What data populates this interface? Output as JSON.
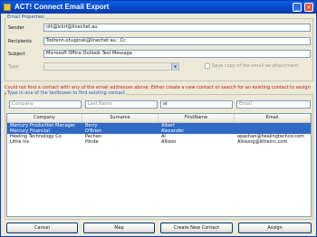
{
  "window": {
    "title": "ACT! Connect Email Export",
    "minimize_glyph": "_",
    "close_glyph": "×"
  },
  "email_properties": {
    "legend": "Email Properties",
    "sender_label": "Sender",
    "sender_value": "olh@ickrt@linechet.au",
    "recipients_label": "Recipients",
    "recipients_value": "Todrenn.ohuginsk@linechet.au ; Cc",
    "subject_label": "Subject",
    "subject_value": "Microsoft Office Outlook Test Message",
    "type_label": "Type",
    "type_value": "",
    "save_copy_label": "Save copy of the email as attachment",
    "save_copy_checked": false
  },
  "warning": "Could not find a contact with any of the email addresses above. Either create a new contact or search for an existing contact to assign email message to.",
  "search": {
    "legend": "Type in one of the textboxes to find existing contact",
    "company_placeholder": "Company",
    "lastname_placeholder": "Last Name",
    "firstname_value": "al",
    "email_placeholder": "Email"
  },
  "grid": {
    "columns": [
      "Company",
      "Surname",
      "FirstName",
      "Email"
    ],
    "rows": [
      {
        "company": "Mercury Production Manager",
        "surname": "Berry",
        "firstname": "Albert",
        "email": "",
        "selected": true
      },
      {
        "company": "Mercury Financial",
        "surname": "O'Brien",
        "firstname": "Alexander",
        "email": "",
        "selected": true
      },
      {
        "company": "Heeling Technology Co",
        "surname": "Pachan",
        "firstname": "Al",
        "email": "apachan@healingtechco.com",
        "selected": false
      },
      {
        "company": "Little Inc",
        "surname": "Hinde",
        "firstname": "Allison",
        "email": "Allisong@littleinc.com",
        "selected": false
      }
    ]
  },
  "buttons": {
    "cancel": "Cancel",
    "map": "Map",
    "create_new_contact": "Create New Contact",
    "assign": "Assign"
  }
}
